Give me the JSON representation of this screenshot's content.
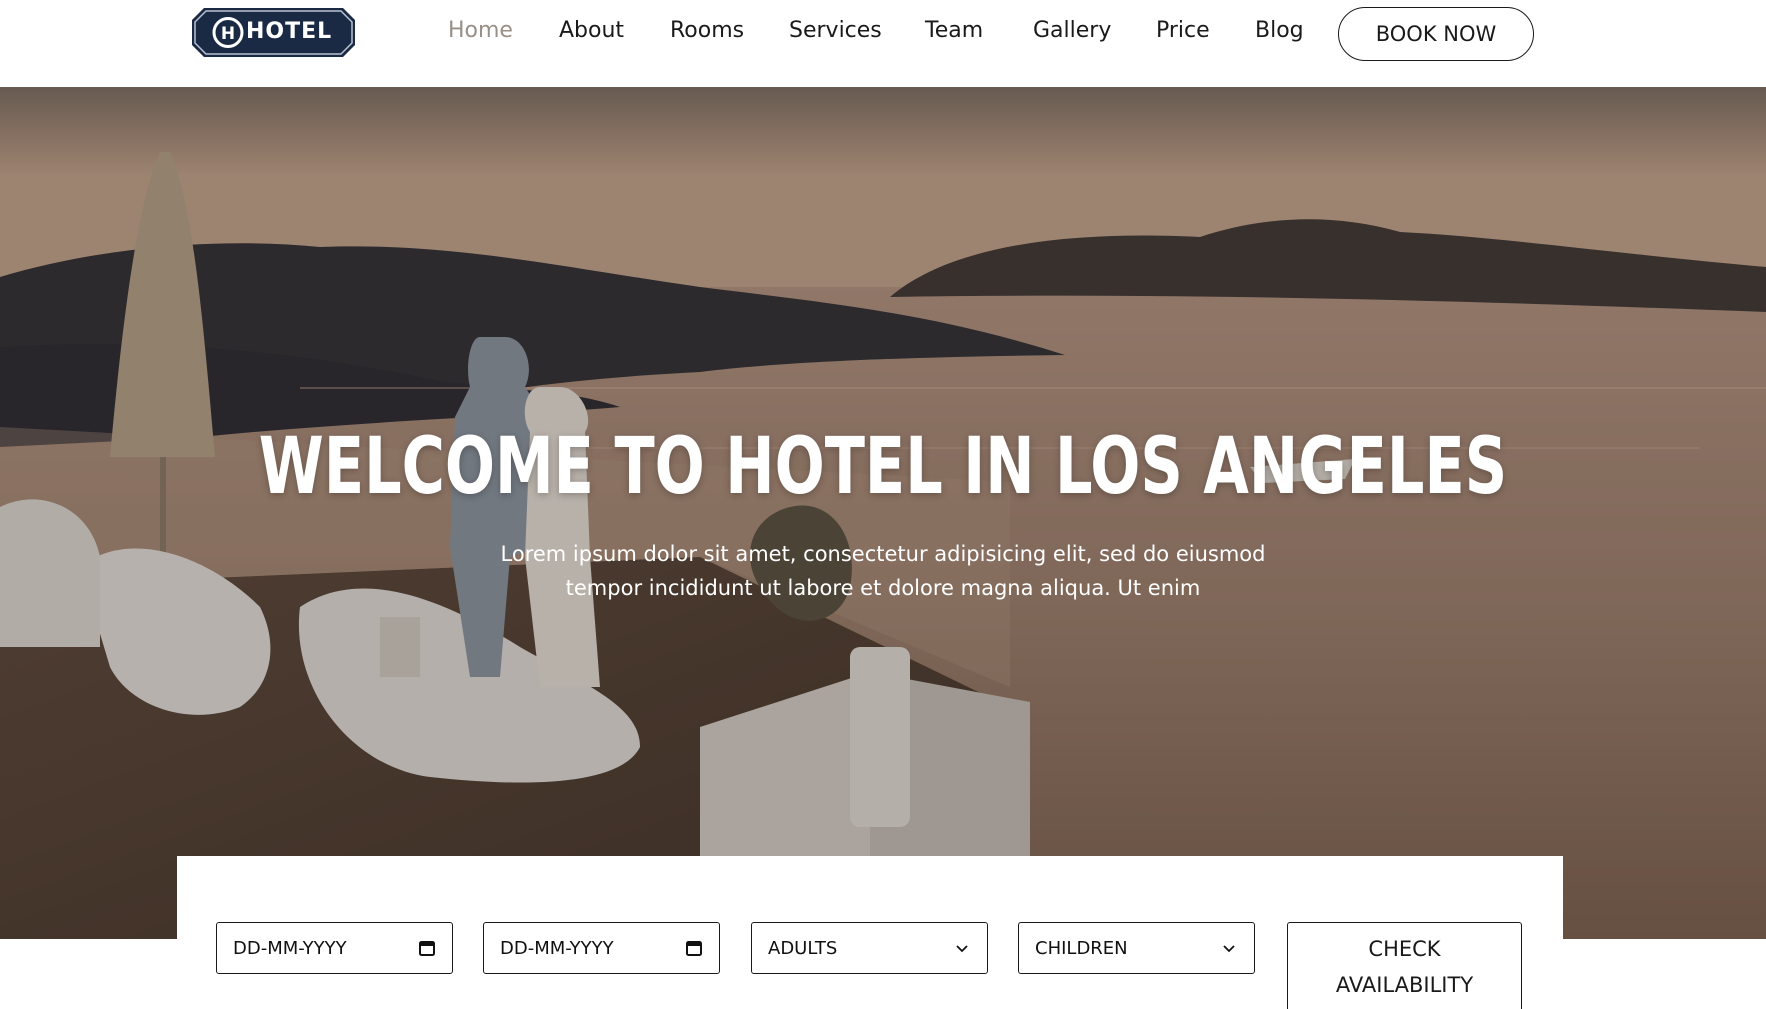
{
  "header": {
    "logo_text": "HOTEL",
    "logo_icon": "hotel-h-badge-icon",
    "nav": [
      {
        "label": "Home",
        "active": true
      },
      {
        "label": "About",
        "active": false
      },
      {
        "label": "Rooms",
        "active": false
      },
      {
        "label": "Services",
        "active": false
      },
      {
        "label": "Team",
        "active": false
      },
      {
        "label": "Gallery",
        "active": false
      },
      {
        "label": "Price",
        "active": false
      },
      {
        "label": "Blog",
        "active": false
      }
    ],
    "book_button": "BOOK NOW"
  },
  "hero": {
    "title": "WELCOME TO HOTEL IN LOS ANGELES",
    "subtitle_line1": "Lorem ipsum dolor sit amet, consectetur adipisicing elit, sed do eiusmod",
    "subtitle_line2": "tempor incididunt ut labore et dolore magna aliqua. Ut enim"
  },
  "booking": {
    "checkin_placeholder": "DD-MM-YYYY",
    "checkout_placeholder": "DD-MM-YYYY",
    "adults_label": "ADULTS",
    "children_label": "CHILDREN",
    "check_line1": "CHECK",
    "check_line2": "AVAILABILITY"
  },
  "colors": {
    "logo_bg": "#1b2a44",
    "nav_active": "#9a8f86",
    "text_dark": "#1a1a1a"
  }
}
